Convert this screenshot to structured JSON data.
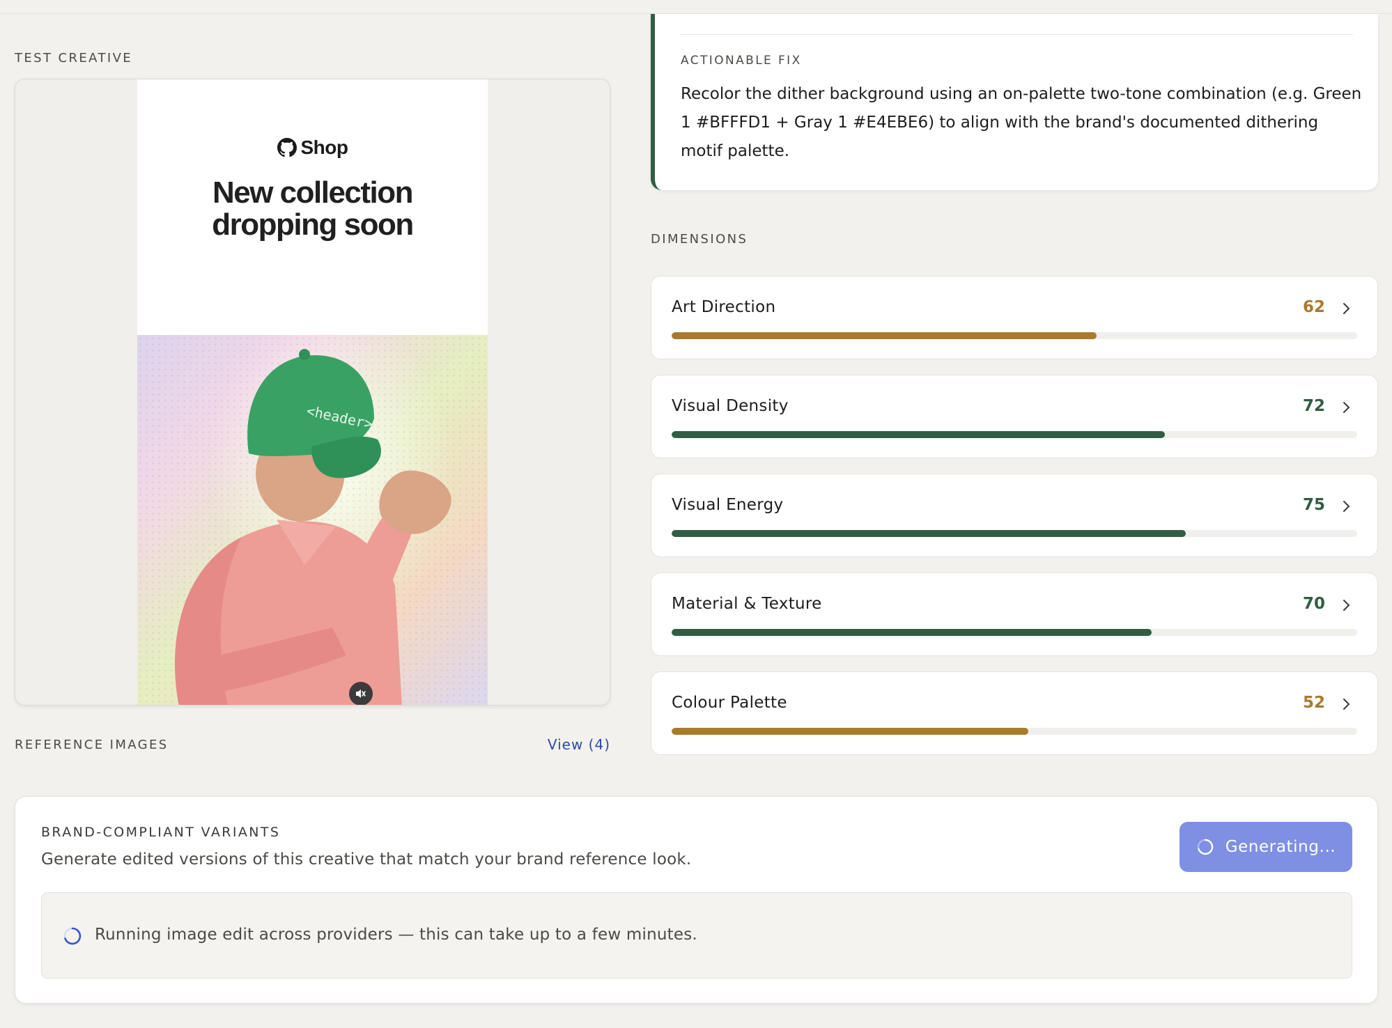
{
  "test_creative": {
    "section_label": "TEST CREATIVE",
    "ad": {
      "brand": "Shop",
      "headline_line1": "New collection",
      "headline_line2": "dropping soon",
      "cap_text": "<header>"
    }
  },
  "reference_images": {
    "section_label": "REFERENCE IMAGES",
    "view_link": "View (4)"
  },
  "actionable_fix": {
    "label": "ACTIONABLE FIX",
    "text": "Recolor the dither background using an on-palette two-tone combination (e.g. Green 1 #BFFFD1 + Gray 1 #E4EBE6) to align with the brand's documented dithering motif palette."
  },
  "dimensions": {
    "section_label": "DIMENSIONS",
    "items": [
      {
        "name": "Art Direction",
        "score": "62",
        "value": 62,
        "color": "#a87b2c"
      },
      {
        "name": "Visual Density",
        "score": "72",
        "value": 72,
        "color": "#2f5e44"
      },
      {
        "name": "Visual Energy",
        "score": "75",
        "value": 75,
        "color": "#2f5e44"
      },
      {
        "name": "Material & Texture",
        "score": "70",
        "value": 70,
        "color": "#2f5e44"
      },
      {
        "name": "Colour Palette",
        "score": "52",
        "value": 52,
        "color": "#a87b2c"
      }
    ]
  },
  "variants": {
    "label": "BRAND-COMPLIANT VARIANTS",
    "description": "Generate edited versions of this creative that match your brand reference look.",
    "button_label": "Generating...",
    "progress_text": "Running image edit across providers — this can take up to a few minutes."
  },
  "colors": {
    "accent_green": "#2f5e44",
    "accent_amber": "#a87b2c",
    "button_blue": "#7f8fe3",
    "link_blue": "#2d4aa8"
  },
  "icons": [
    "github-icon",
    "mute-icon",
    "chevron-right-icon",
    "spinner-icon"
  ]
}
